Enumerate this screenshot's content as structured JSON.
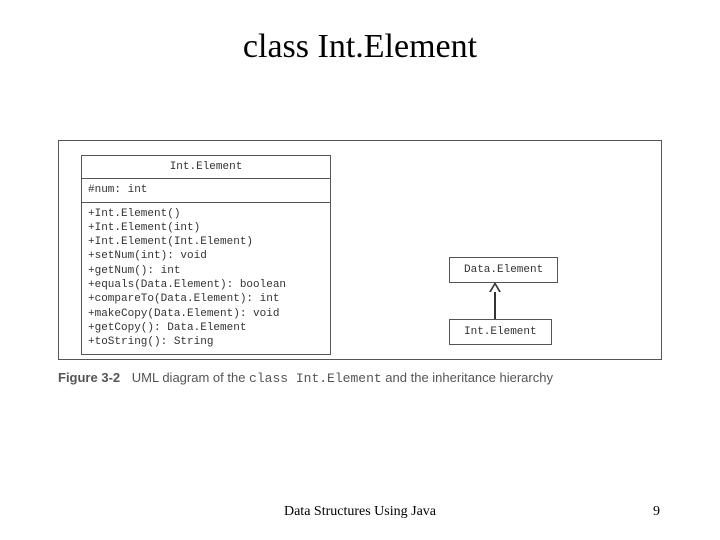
{
  "title": "class Int.Element",
  "uml": {
    "class_name": "Int.Element",
    "attributes": [
      "#num: int"
    ],
    "methods": [
      "+Int.Element()",
      "+Int.Element(int)",
      "+Int.Element(Int.Element)",
      "+setNum(int): void",
      "+getNum(): int",
      "+equals(Data.Element): boolean",
      "+compareTo(Data.Element): int",
      "+makeCopy(Data.Element): void",
      "+getCopy(): Data.Element",
      "+toString(): String"
    ]
  },
  "hierarchy": {
    "parent": "Data.Element",
    "child": "Int.Element"
  },
  "caption": {
    "label": "Figure 3-2",
    "pre": "UML diagram of the ",
    "code": "class Int.Element",
    "post": " and the inheritance hierarchy"
  },
  "footer": {
    "center": "Data Structures Using Java",
    "page": "9"
  }
}
